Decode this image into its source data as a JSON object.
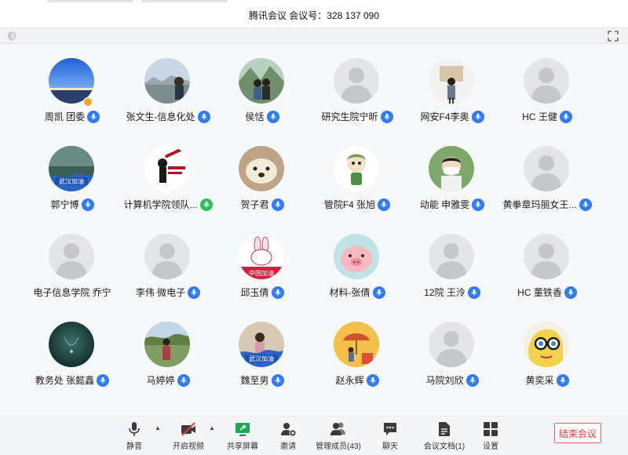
{
  "window": {
    "title": "腾讯会议 会议号：328 137 090"
  },
  "participants": [
    {
      "name": "周凯 团委",
      "mic": "on",
      "host": true,
      "avatar": "sky-photo-avatar"
    },
    {
      "name": "张文生-信息化处",
      "mic": "on",
      "avatar": "landscape-photo-avatar"
    },
    {
      "name": "侯恬",
      "mic": "on",
      "avatar": "couple-photo-avatar"
    },
    {
      "name": "研究生院宁昕",
      "mic": "on",
      "avatar": "default-avatar"
    },
    {
      "name": "网安F4李奥",
      "mic": "on",
      "avatar": "portrait-photo-avatar"
    },
    {
      "name": "HC 王健",
      "mic": "on",
      "avatar": "default-avatar"
    },
    {
      "name": "郭宁博",
      "mic": "on",
      "avatar": "wuhan-jiayou-avatar"
    },
    {
      "name": "计算机学院领队...",
      "mic": "speaking",
      "avatar": "conan-avatar"
    },
    {
      "name": "贺子君",
      "mic": "on",
      "avatar": "dog-avatar"
    },
    {
      "name": "管院F4  张旭",
      "mic": "on",
      "avatar": "cartoon-boy-avatar"
    },
    {
      "name": "动能 申雅雯",
      "mic": "on",
      "avatar": "masked-child-avatar"
    },
    {
      "name": "黄拳章玛丽女王...",
      "mic": "on",
      "avatar": "default-avatar"
    },
    {
      "name": "电子信息学院 乔宁",
      "mic": "none",
      "avatar": "default-avatar"
    },
    {
      "name": "李伟 微电子",
      "mic": "on",
      "avatar": "default-avatar"
    },
    {
      "name": "邱玉倩",
      "mic": "on",
      "avatar": "rabbit-china-jiayou-avatar"
    },
    {
      "name": "材料-张倩",
      "mic": "on",
      "avatar": "pig-avatar"
    },
    {
      "name": "12院 王泠",
      "mic": "on",
      "avatar": "default-avatar"
    },
    {
      "name": "HC 董铁香",
      "mic": "on",
      "avatar": "default-avatar"
    },
    {
      "name": "教务处 张懿鑫",
      "mic": "on",
      "avatar": "dark-teal-avatar"
    },
    {
      "name": "马婷婷",
      "mic": "on",
      "avatar": "garden-photo-avatar"
    },
    {
      "name": "魏至男",
      "mic": "on",
      "avatar": "wuhan-jiayou-photo-avatar"
    },
    {
      "name": "赵永辉",
      "mic": "on",
      "avatar": "umbrella-art-avatar"
    },
    {
      "name": "马院刘欣",
      "mic": "on",
      "avatar": "default-avatar"
    },
    {
      "name": "黄奕采",
      "mic": "on",
      "avatar": "glasses-art-avatar"
    }
  ],
  "toolbar": {
    "mute": "静音",
    "video": "开启视频",
    "share": "共享屏幕",
    "invite": "邀请",
    "manage": "管理成员(43)",
    "chat": "聊天",
    "docs": "会议文档(1)",
    "settings": "设置",
    "end": "结束会议"
  },
  "colors": {
    "mic_blue": "#2f7cf6",
    "mic_green": "#2fbf5a",
    "share_green": "#1aaa55",
    "end_red": "#e03c3c",
    "video_off_red": "#e03c3c"
  }
}
